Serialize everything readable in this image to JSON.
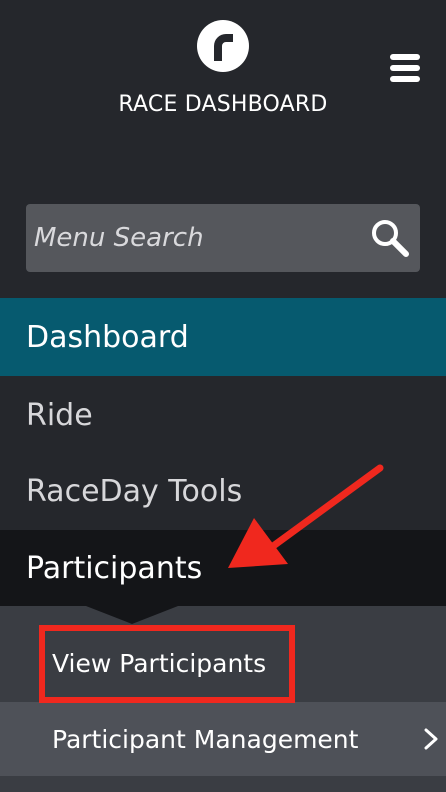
{
  "header": {
    "app_title": "RACE DASHBOARD",
    "logo_icon": "race-logo-icon",
    "menu_icon": "hamburger-menu-icon"
  },
  "search": {
    "placeholder": "Menu Search",
    "icon": "search-icon"
  },
  "nav": {
    "items": [
      {
        "label": "Dashboard",
        "state": "active"
      },
      {
        "label": "Ride"
      },
      {
        "label": "RaceDay Tools"
      },
      {
        "label": "Participants",
        "state": "expanded"
      }
    ],
    "participants_submenu": [
      {
        "label": "View Participants"
      },
      {
        "label": "Participant Management",
        "icon": "chevron-right-icon"
      }
    ]
  },
  "annotations": {
    "highlight_color": "#f0281e",
    "arrow_color": "#f0281e"
  },
  "colors": {
    "background": "#25272c",
    "active_item": "#065a6f",
    "expanded_item": "#141518",
    "submenu_bg": "#3a3d43",
    "search_bg": "#55575c"
  }
}
